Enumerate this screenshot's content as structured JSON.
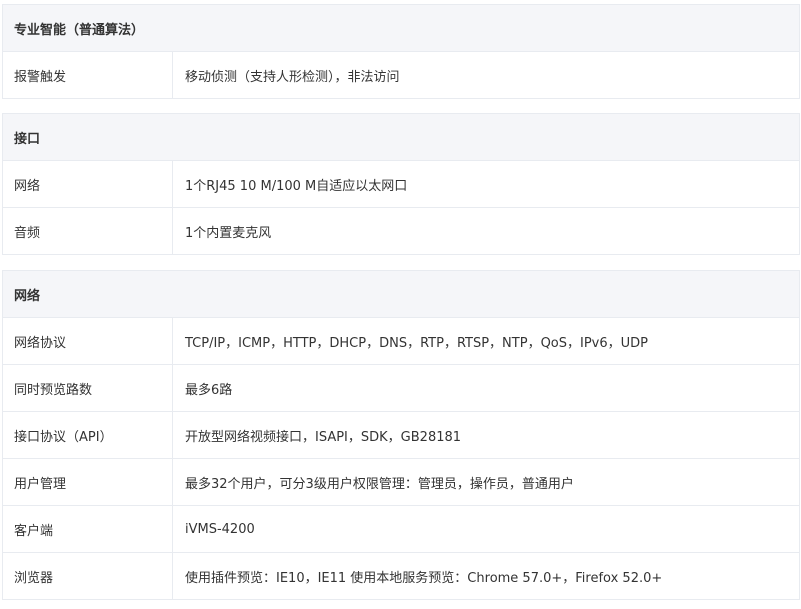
{
  "sections": [
    {
      "title": "专业智能（普通算法）",
      "rows": [
        {
          "label": "报警触发",
          "value": "移动侦测（支持人形检测），非法访问"
        }
      ]
    },
    {
      "title": "接口",
      "rows": [
        {
          "label": "网络",
          "value": "1个RJ45 10 M/100 M自适应以太网口"
        },
        {
          "label": "音频",
          "value": "1个内置麦克风"
        }
      ]
    },
    {
      "title": "网络",
      "rows": [
        {
          "label": "网络协议",
          "value": "TCP/IP，ICMP，HTTP，DHCP，DNS，RTP，RTSP，NTP，QoS，IPv6，UDP"
        },
        {
          "label": "同时预览路数",
          "value": "最多6路"
        },
        {
          "label": "接口协议（API）",
          "value": "开放型网络视频接口，ISAPI，SDK，GB28181"
        },
        {
          "label": "用户管理",
          "value": "最多32个用户，可分3级用户权限管理：管理员，操作员，普通用户"
        },
        {
          "label": "客户端",
          "value": "iVMS-4200"
        },
        {
          "label": "浏览器",
          "value": "使用插件预览：IE10，IE11 使用本地服务预览：Chrome 57.0+，Firefox 52.0+"
        }
      ]
    }
  ]
}
